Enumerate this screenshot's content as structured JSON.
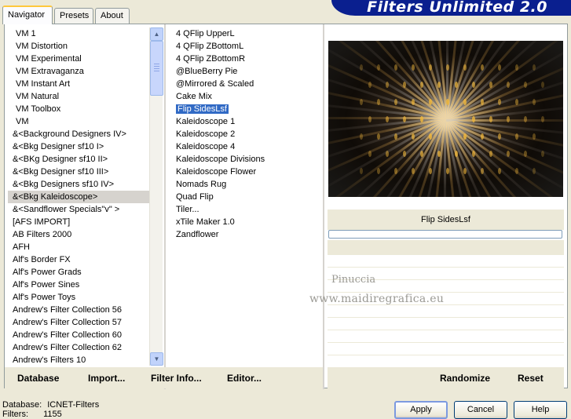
{
  "tabs": [
    "Navigator",
    "Presets",
    "About"
  ],
  "banner_title": "Filters Unlimited 2.0",
  "categories": [
    "VM 1",
    "VM Distortion",
    "VM Experimental",
    "VM Extravaganza",
    "VM Instant Art",
    "VM Natural",
    "VM Toolbox",
    "VM",
    "&<Background Designers IV>",
    "&<Bkg Designer sf10 I>",
    "&<BKg Designer sf10 II>",
    "&<Bkg Designer sf10 III>",
    "&<Bkg Designers sf10 IV>",
    "&<Bkg Kaleidoscope>",
    "&<Sandflower Specials\"v\" >",
    "[AFS IMPORT]",
    "AB Filters 2000",
    "AFH",
    "Alf's Border FX",
    "Alf's Power Grads",
    "Alf's Power Sines",
    "Alf's Power Toys",
    "Andrew's Filter Collection 56",
    "Andrew's Filter Collection 57",
    "Andrew's Filter Collection 60",
    "Andrew's Filter Collection 62",
    "Andrew's Filters 10"
  ],
  "selected_category": "&<Bkg Kaleidoscope>",
  "filters": [
    "4 QFlip UpperL",
    "4 QFlip ZBottomL",
    "4 QFlip ZBottomR",
    "@BlueBerry Pie",
    "@Mirrored & Scaled",
    "Cake Mix",
    "Flip SidesLsf",
    "Kaleidoscope 1",
    "Kaleidoscope 2",
    "Kaleidoscope 4",
    "Kaleidoscope Divisions",
    "Kaleidoscope Flower",
    "Nomads Rug",
    "Quad Flip",
    "Tiler...",
    "xTile Maker 1.0",
    "Zandflower"
  ],
  "selected_filter": "Flip SidesLsf",
  "preview_filter_name": "Flip SidesLsf",
  "watermark": {
    "line1": "Pinuccia",
    "line2": "www.maidiregrafica.eu"
  },
  "bottom_buttons": {
    "database": "Database",
    "import": "Import...",
    "filter_info": "Filter Info...",
    "editor": "Editor...",
    "randomize": "Randomize",
    "reset": "Reset"
  },
  "info": {
    "database_label": "Database:",
    "database_value": "ICNET-Filters",
    "filters_label": "Filters:",
    "filters_value": "1155"
  },
  "dialog_buttons": {
    "apply": "Apply",
    "cancel": "Cancel",
    "help": "Help"
  },
  "colors": {
    "banner": "#0a1f8f",
    "selection": "#316ac5",
    "active_tab_accent": "#ffc83c"
  }
}
